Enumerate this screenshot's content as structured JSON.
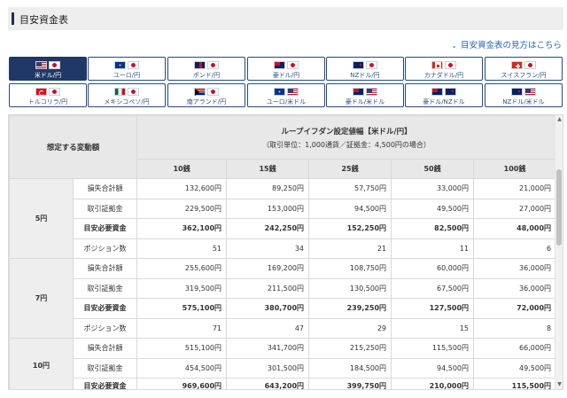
{
  "page": {
    "title": "目安資金表"
  },
  "help_link": {
    "label": "目安資金表の見方はこちら",
    "icon": "chevron-down-icon"
  },
  "pairs": [
    {
      "id": "usdjpy",
      "label": "米ドル/円",
      "flags": [
        "f-us",
        "f-jp"
      ],
      "active": true
    },
    {
      "id": "eurjpy",
      "label": "ユーロ/円",
      "flags": [
        "f-eu",
        "f-jp"
      ]
    },
    {
      "id": "gbpjpy",
      "label": "ポンド/円",
      "flags": [
        "f-gb",
        "f-jp"
      ]
    },
    {
      "id": "audjpy",
      "label": "豪ドル/円",
      "flags": [
        "f-au",
        "f-jp"
      ]
    },
    {
      "id": "nzdjpy",
      "label": "NZドル/円",
      "flags": [
        "f-nz",
        "f-jp"
      ]
    },
    {
      "id": "cadjpy",
      "label": "カナダドル/円",
      "flags": [
        "f-ca",
        "f-jp"
      ]
    },
    {
      "id": "chfjpy",
      "label": "スイスフラン/円",
      "flags": [
        "f-ch",
        "f-jp"
      ]
    },
    {
      "id": "tryjpy",
      "label": "トルコリラ/円",
      "flags": [
        "f-tr",
        "f-jp"
      ]
    },
    {
      "id": "mxnjpy",
      "label": "メキシコペソ/円",
      "flags": [
        "f-mx",
        "f-jp"
      ]
    },
    {
      "id": "zarjpy",
      "label": "南アランド/円",
      "flags": [
        "f-za",
        "f-jp"
      ]
    },
    {
      "id": "eurusd",
      "label": "ユーロ/米ドル",
      "flags": [
        "f-eu",
        "f-us"
      ]
    },
    {
      "id": "audusd",
      "label": "豪ドル/米ドル",
      "flags": [
        "f-au",
        "f-us"
      ]
    },
    {
      "id": "audnzd",
      "label": "豪ドル/NZドル",
      "flags": [
        "f-au",
        "f-nz"
      ]
    },
    {
      "id": "nzdusd",
      "label": "NZドル/米ドル",
      "flags": [
        "f-nz",
        "f-us"
      ]
    }
  ],
  "table": {
    "scenario_header": "想定する変動額",
    "main_header": "ループイフダン設定値幅【米ドル/円】",
    "sub_header": "（取引単位：1,000通貨／証拠金：4,500円の場合）",
    "columns": [
      "10銭",
      "15銭",
      "25銭",
      "50銭",
      "100銭"
    ],
    "scenarios": [
      {
        "label": "5円",
        "rows": [
          {
            "item": "損失合計額",
            "bold": false,
            "values": [
              "132,600円",
              "89,250円",
              "57,750円",
              "33,000円",
              "21,000円"
            ]
          },
          {
            "item": "取引証拠金",
            "bold": false,
            "values": [
              "229,500円",
              "153,000円",
              "94,500円",
              "49,500円",
              "27,000円"
            ]
          },
          {
            "item": "目安必要資金",
            "bold": true,
            "values": [
              "362,100円",
              "242,250円",
              "152,250円",
              "82,500円",
              "48,000円"
            ]
          },
          {
            "item": "ポジション数",
            "bold": false,
            "values": [
              "51",
              "34",
              "21",
              "11",
              "6"
            ]
          }
        ]
      },
      {
        "label": "7円",
        "rows": [
          {
            "item": "損失合計額",
            "bold": false,
            "values": [
              "255,600円",
              "169,200円",
              "108,750円",
              "60,000円",
              "36,000円"
            ]
          },
          {
            "item": "取引証拠金",
            "bold": false,
            "values": [
              "319,500円",
              "211,500円",
              "130,500円",
              "67,500円",
              "36,000円"
            ]
          },
          {
            "item": "目安必要資金",
            "bold": true,
            "values": [
              "575,100円",
              "380,700円",
              "239,250円",
              "127,500円",
              "72,000円"
            ]
          },
          {
            "item": "ポジション数",
            "bold": false,
            "values": [
              "71",
              "47",
              "29",
              "15",
              "8"
            ]
          }
        ]
      },
      {
        "label": "10円",
        "rows": [
          {
            "item": "損失合計額",
            "bold": false,
            "values": [
              "515,100円",
              "341,700円",
              "215,250円",
              "115,500円",
              "66,000円"
            ]
          },
          {
            "item": "取引証拠金",
            "bold": false,
            "values": [
              "454,500円",
              "301,500円",
              "184,500円",
              "94,500円",
              "49,500円"
            ]
          },
          {
            "item": "目安必要資金",
            "bold": true,
            "values": [
              "969,600円",
              "643,200円",
              "399,750円",
              "210,000円",
              "115,500円"
            ]
          }
        ]
      }
    ]
  },
  "colors": {
    "active_button": "#1f3866",
    "button_border": "#264a86",
    "link": "#2864b4",
    "header_bg": "#e8e8e8"
  }
}
